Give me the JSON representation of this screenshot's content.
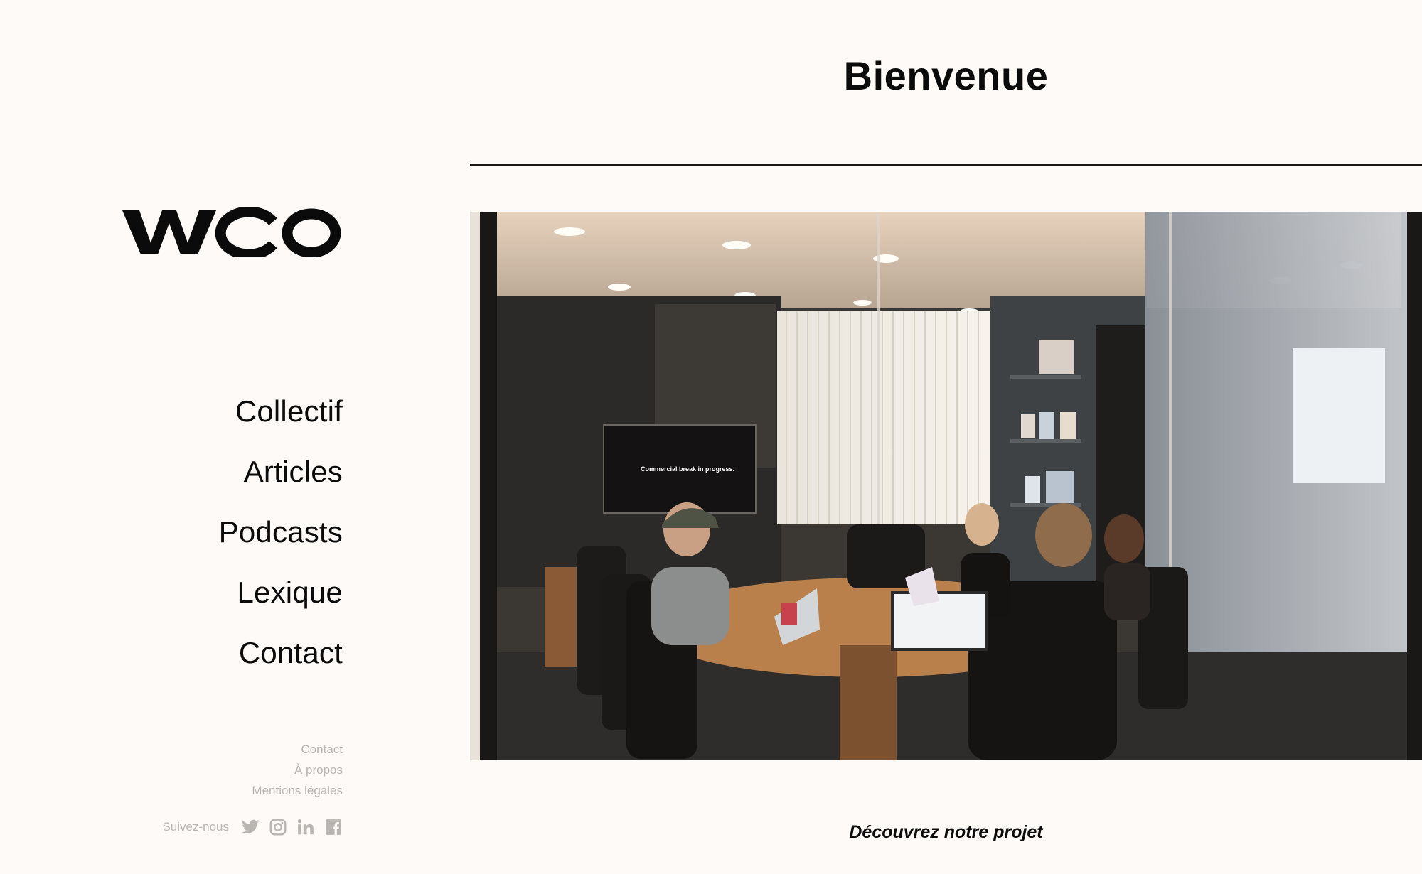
{
  "brand": {
    "logo_text": "WCO"
  },
  "nav": {
    "items": [
      {
        "label": "Collectif"
      },
      {
        "label": "Articles"
      },
      {
        "label": "Podcasts"
      },
      {
        "label": "Lexique"
      },
      {
        "label": "Contact"
      }
    ]
  },
  "footer": {
    "links": [
      {
        "label": "Contact"
      },
      {
        "label": "À propos"
      },
      {
        "label": "Mentions légales"
      }
    ],
    "follow_label": "Suivez-nous",
    "social_icons": [
      "twitter-icon",
      "instagram-icon",
      "linkedin-icon",
      "facebook-icon"
    ]
  },
  "main": {
    "title": "Bienvenue",
    "hero_screen_text": "Commercial break in progress.",
    "cta_label": "Découvrez notre projet"
  },
  "colors": {
    "background": "#fdfaf7",
    "text": "#0b0b0b",
    "muted": "#b9b5b1"
  }
}
